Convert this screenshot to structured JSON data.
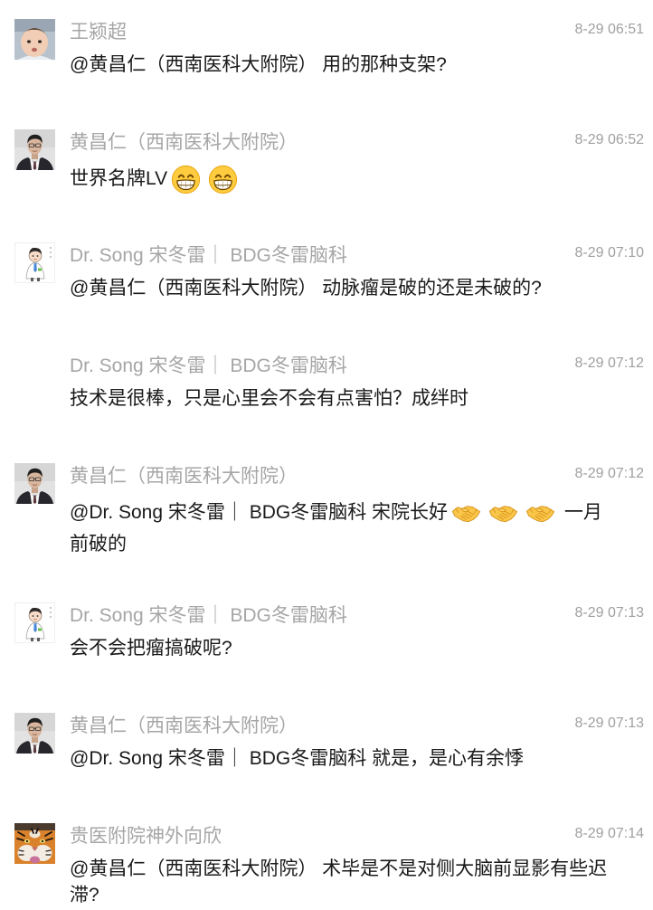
{
  "chat": {
    "colors": {
      "background": "#ffffff",
      "sender_name": "#a6a6a6",
      "timestamp": "#a0a0a0",
      "message_text": "#1a1a1a"
    },
    "messages": [
      {
        "sender": "王颍超",
        "time": "8-29 06:51",
        "avatar": "baby-photo-avatar",
        "content": [
          {
            "text": "@黄昌仁（西南医科大附院） 用的那种支架?"
          }
        ]
      },
      {
        "sender": "黄昌仁（西南医科大附院）",
        "time": "8-29 06:52",
        "avatar": "man-in-suit-avatar",
        "content": [
          {
            "text": "世界名牌LV"
          },
          {
            "emoji": "grinning-face-emoji"
          },
          {
            "emoji": "grinning-face-emoji"
          }
        ]
      },
      {
        "sender": "Dr. Song 宋冬雷｜ BDG冬雷脑科",
        "time": "8-29 07:10",
        "avatar": "cartoon-doctor-avatar",
        "content": [
          {
            "text": "@黄昌仁（西南医科大附院） 动脉瘤是破的还是未破的?"
          }
        ]
      },
      {
        "sender": "Dr. Song 宋冬雷｜ BDG冬雷脑科",
        "time": "8-29 07:12",
        "content": [
          {
            "text": "技术是很棒，只是心里会不会有点害怕？成绊时"
          }
        ]
      },
      {
        "sender": "黄昌仁（西南医科大附院）",
        "time": "8-29 07:12",
        "avatar": "man-in-suit-avatar",
        "content": [
          {
            "text": "@Dr. Song 宋冬雷｜ BDG冬雷脑科 宋院长好"
          },
          {
            "emoji": "handshake-emoji"
          },
          {
            "emoji": "handshake-emoji"
          },
          {
            "emoji": "handshake-emoji"
          },
          {
            "text": " 一月前破的"
          }
        ]
      },
      {
        "sender": "Dr. Song 宋冬雷｜ BDG冬雷脑科",
        "time": "8-29 07:13",
        "avatar": "cartoon-doctor-avatar",
        "content": [
          {
            "text": "会不会把瘤搞破呢?"
          }
        ]
      },
      {
        "sender": "黄昌仁（西南医科大附院）",
        "time": "8-29 07:13",
        "avatar": "man-in-suit-avatar",
        "content": [
          {
            "text": "@Dr. Song 宋冬雷｜ BDG冬雷脑科 就是，是心有余悸"
          }
        ]
      },
      {
        "sender": "贵医附院神外向欣",
        "time": "8-29 07:14",
        "avatar": "tiger-photo-avatar",
        "content": [
          {
            "text": "@黄昌仁（西南医科大附院） 术毕是不是对侧大脑前显影有些迟滞?"
          }
        ]
      }
    ]
  }
}
